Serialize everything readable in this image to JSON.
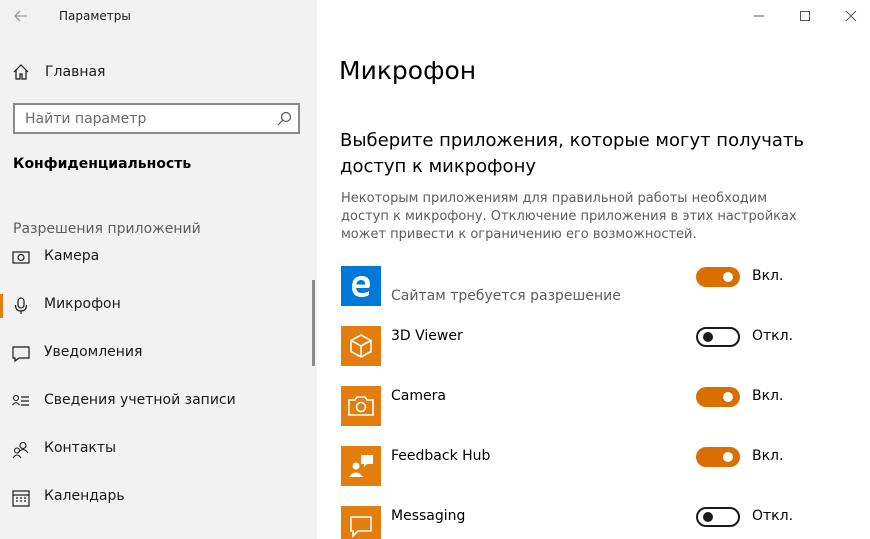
{
  "window": {
    "title": "Параметры",
    "controls": [
      "minimize-icon",
      "maximize-icon",
      "close-icon"
    ]
  },
  "sidebar": {
    "home_label": "Главная",
    "search_placeholder": "Найти параметр",
    "section_title": "Конфиденциальность",
    "group_title": "Разрешения приложений",
    "items": [
      {
        "label": "Камера",
        "icon": "camera-icon"
      },
      {
        "label": "Микрофон",
        "icon": "microphone-icon",
        "active": true
      },
      {
        "label": "Уведомления",
        "icon": "notifications-icon"
      },
      {
        "label": "Сведения учетной записи",
        "icon": "account-info-icon"
      },
      {
        "label": "Контакты",
        "icon": "contacts-icon"
      },
      {
        "label": "Календарь",
        "icon": "calendar-icon"
      }
    ]
  },
  "main": {
    "title": "Микрофон",
    "heading": "Выберите приложения, которые могут получать доступ к микрофону",
    "description": "Некоторым приложениям для правильной работы необходим доступ к микрофону. Отключение приложения в этих настройках может привести к ограничению его возможностей.",
    "apps": [
      {
        "name": "",
        "subtitle": "Сайтам требуется разрешение",
        "icon": "edge-icon",
        "icon_bg": "#0078d7",
        "state": "on",
        "state_label": "Вкл."
      },
      {
        "name": "3D Viewer",
        "subtitle": "",
        "icon": "3d-viewer-icon",
        "icon_bg": "#e27d0e",
        "state": "off",
        "state_label": "Откл."
      },
      {
        "name": "Camera",
        "subtitle": "",
        "icon": "camera-app-icon",
        "icon_bg": "#e27d0e",
        "state": "on",
        "state_label": "Вкл."
      },
      {
        "name": "Feedback Hub",
        "subtitle": "",
        "icon": "feedback-hub-icon",
        "icon_bg": "#e27d0e",
        "state": "on",
        "state_label": "Вкл."
      },
      {
        "name": "Messaging",
        "subtitle": "",
        "icon": "messaging-icon",
        "icon_bg": "#e27d0e",
        "state": "off",
        "state_label": "Откл."
      }
    ]
  },
  "colors": {
    "accent": "#d96f00",
    "sidebar_bg": "#f2f2f2",
    "edge_blue": "#0078d7"
  }
}
